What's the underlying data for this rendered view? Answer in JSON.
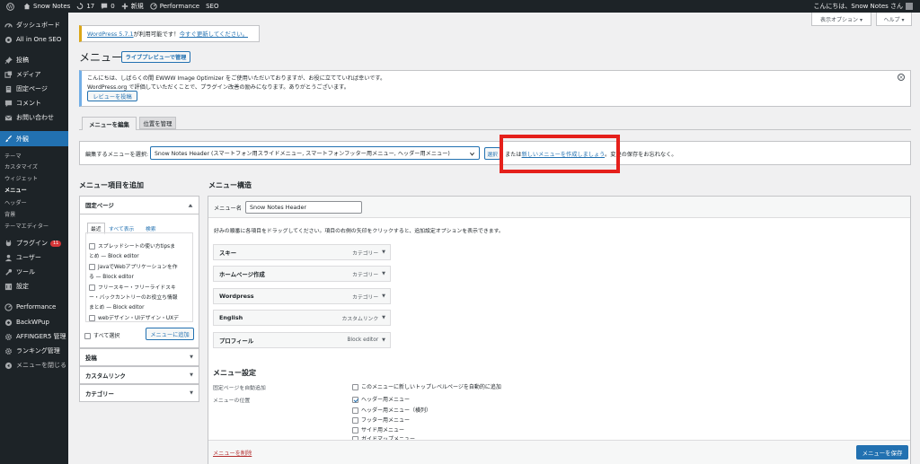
{
  "adminbar": {
    "site_name": "Snow Notes",
    "updates_count": "17",
    "comments_count": "0",
    "new_label": "新規",
    "performance_label": "Performance",
    "seo_label": "SEO",
    "greeting": "こんにちは、Snow Notes さん"
  },
  "sidebar": {
    "items": [
      {
        "label": "ダッシュボード"
      },
      {
        "label": "All in One SEO"
      },
      {
        "label": "投稿"
      },
      {
        "label": "メディア"
      },
      {
        "label": "固定ページ"
      },
      {
        "label": "コメント"
      },
      {
        "label": "お問い合わせ"
      },
      {
        "label": "外観"
      },
      {
        "label": "プラグイン"
      },
      {
        "label": "ユーザー"
      },
      {
        "label": "ツール"
      },
      {
        "label": "設定"
      },
      {
        "label": "Performance"
      },
      {
        "label": "BackWPup"
      },
      {
        "label": "AFFINGER5 管理"
      },
      {
        "label": "ランキング管理"
      },
      {
        "label": "メニューを閉じる"
      }
    ],
    "plugins_badge": "11",
    "submenu": [
      "テーマ",
      "カスタマイズ",
      "ウィジェット",
      "メニュー",
      "ヘッダー",
      "背景",
      "テーマエディター"
    ]
  },
  "screen_options": "表示オプション ▾",
  "help": "ヘルプ ▾",
  "update_notice": {
    "link1": "WordPress 5.7.1",
    "mid": " が利用可能です！",
    "link2": "今すぐ更新してください。"
  },
  "page_title": "メニュー",
  "live_preview_button": "ライブプレビューで管理",
  "ewww_notice": {
    "line1": "こんにちは、しばらくの間 EWWW Image Optimizer をご使用いただいておりますが、お役に立てていれば幸いです。",
    "line2": "WordPress.org で評価していただくことで、プラグイン改善の励みになります。ありがとうございます。",
    "button": "レビューを投稿"
  },
  "tabs": [
    "メニューを編集",
    "位置を管理"
  ],
  "select_row": {
    "label": "編集するメニューを選択:",
    "selected": "Snow Notes Header (スマートフォン用スライドメニュー, スマートフォンフッター用メニュー, ヘッダー用メニュー)",
    "select_button": "選択",
    "or_text": "または",
    "create_link": "新しいメニューを作成しましょう",
    "after_text": "。変更の保存をお忘れなく。"
  },
  "left": {
    "heading": "メニュー項目を追加",
    "fixed_pages": {
      "title": "固定ページ",
      "tabs": [
        "最近",
        "すべて表示",
        "検索"
      ],
      "pages": [
        {
          "line1": "スプレッドシートの使い方tipsま",
          "line2": "とめ — Block editor"
        },
        {
          "line1": "JavaでWebアプリケーションを作",
          "line2": "る — Block editor"
        },
        {
          "line1": "フリースキー・フリーライドスキ",
          "line2": "ー・バックカントリーのお役立ち情報",
          "line3": "まとめ — Block editor"
        },
        {
          "line1": "webデザイン・UIデザイン・UXデ"
        }
      ],
      "select_all": "すべて選択",
      "add_button": "メニューに追加"
    },
    "accordions": [
      "投稿",
      "カスタムリンク",
      "カテゴリー"
    ]
  },
  "right": {
    "heading": "メニュー構造",
    "menu_name_label": "メニュー名",
    "menu_name_value": "Snow Notes Header",
    "instructions": "好みの順番に各項目をドラッグしてください。項目の右側の矢印をクリックすると、追加設定オプションを表示できます。",
    "items": [
      {
        "title": "スキー",
        "type": "カテゴリー"
      },
      {
        "title": "ホームページ作成",
        "type": "カテゴリー"
      },
      {
        "title": "Wordpress",
        "type": "カテゴリー"
      },
      {
        "title": "English",
        "type": "カスタムリンク"
      },
      {
        "title": "プロフィール",
        "type": "Block editor"
      }
    ],
    "settings": {
      "title": "メニュー設定",
      "auto_add_label": "固定ページを自動追加",
      "auto_add_option": "このメニューに新しいトップレベルページを自動的に追加",
      "location_label": "メニューの位置",
      "locations": [
        {
          "label": "ヘッダー用メニュー",
          "checked": true
        },
        {
          "label": "ヘッダー用メニュー（横列）",
          "checked": false
        },
        {
          "label": "フッター用メニュー",
          "checked": false
        },
        {
          "label": "サイド用メニュー",
          "checked": false
        },
        {
          "label": "ガイドマップメニュー",
          "checked": false
        }
      ]
    },
    "delete_link": "メニューを削除",
    "save_button": "メニューを保存"
  },
  "colors": {
    "accent": "#2271b1",
    "highlight": "#e5201b",
    "sidebar_bg": "#1d2327"
  }
}
